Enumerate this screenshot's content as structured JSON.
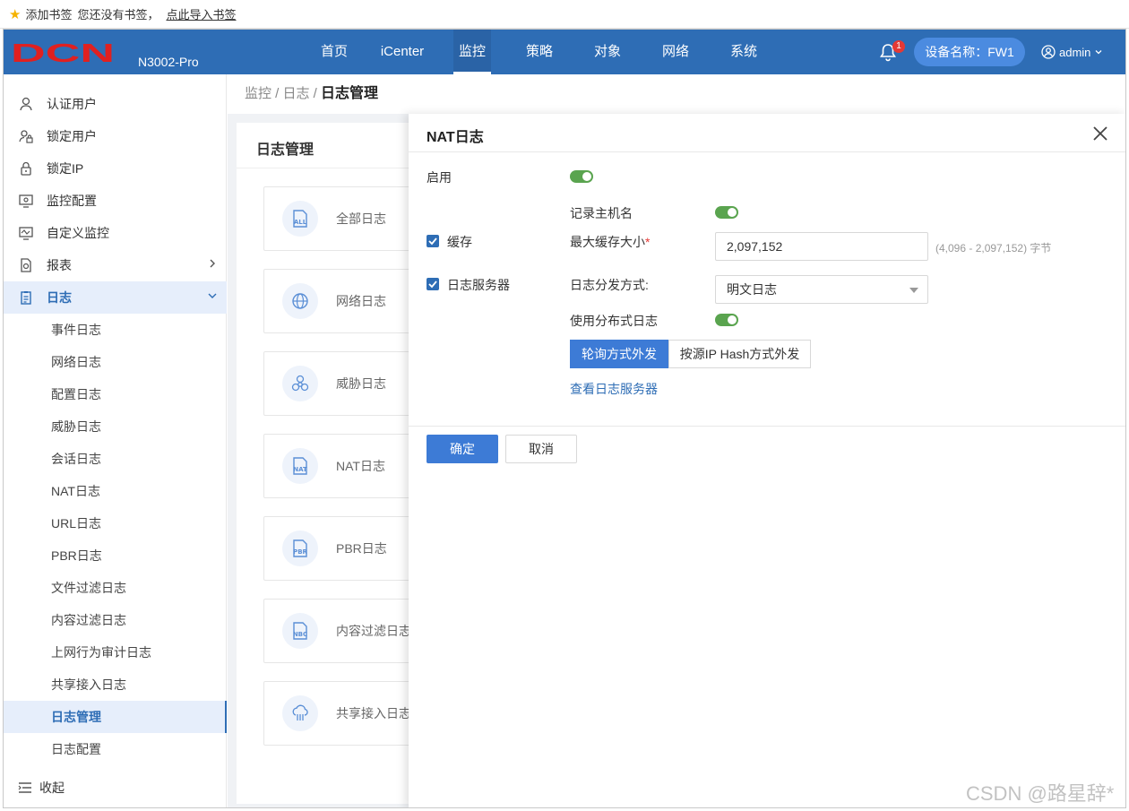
{
  "bookmark_bar": {
    "add_label": "添加书签",
    "empty_text": "您还没有书签，",
    "import_link": "点此导入书签"
  },
  "header": {
    "logo_text": "DCN",
    "model": "N3002-Pro",
    "nav": [
      "首页",
      "iCenter",
      "监控",
      "策略",
      "对象",
      "网络",
      "系统"
    ],
    "active_nav": "监控",
    "notification_count": "1",
    "device_name": "设备名称：FW1",
    "user": "admin"
  },
  "sidebar": {
    "items": [
      {
        "label": "认证用户",
        "icon": "user-icon"
      },
      {
        "label": "锁定用户",
        "icon": "user-lock-icon"
      },
      {
        "label": "锁定IP",
        "icon": "lock-icon"
      },
      {
        "label": "监控配置",
        "icon": "monitor-config-icon"
      },
      {
        "label": "自定义监控",
        "icon": "custom-monitor-icon"
      },
      {
        "label": "报表",
        "icon": "report-icon"
      },
      {
        "label": "日志",
        "icon": "log-icon"
      }
    ],
    "sub_items": [
      "事件日志",
      "网络日志",
      "配置日志",
      "威胁日志",
      "会话日志",
      "NAT日志",
      "URL日志",
      "PBR日志",
      "文件过滤日志",
      "内容过滤日志",
      "上网行为审计日志",
      "共享接入日志",
      "日志管理",
      "日志配置"
    ],
    "active_sub": "日志管理",
    "collapse_label": "收起"
  },
  "breadcrumb": {
    "path": "监控 / 日志 / ",
    "current": "日志管理"
  },
  "panel": {
    "title": "日志管理",
    "cards": [
      {
        "label": "全部日志",
        "icon": "all-log-icon"
      },
      {
        "label": "网络日志",
        "icon": "globe-icon"
      },
      {
        "label": "威胁日志",
        "icon": "biohazard-icon"
      },
      {
        "label": "NAT日志",
        "icon": "nat-file-icon"
      },
      {
        "label": "PBR日志",
        "icon": "pbr-file-icon"
      },
      {
        "label": "内容过滤日志",
        "icon": "nbc-file-icon"
      },
      {
        "label": "共享接入日志",
        "icon": "cloud-share-icon"
      }
    ]
  },
  "drawer": {
    "title": "NAT日志",
    "enable_label": "启用",
    "record_hostname_label": "记录主机名",
    "cache_label": "缓存",
    "max_cache_label": "最大缓存大小",
    "required_mark": "*",
    "max_cache_value": "2,097,152",
    "max_cache_hint": "(4,096 - 2,097,152) 字节",
    "log_server_label": "日志服务器",
    "dispatch_mode_label": "日志分发方式:",
    "dispatch_mode_value": "明文日志",
    "distributed_label": "使用分布式日志",
    "seg_poll": "轮询方式外发",
    "seg_hash": "按源IP Hash方式外发",
    "view_servers_link": "查看日志服务器",
    "ok_button": "确定",
    "cancel_button": "取消"
  },
  "watermark": "CSDN @路星辞*",
  "colors": {
    "nav_bg": "#2e6db5",
    "primary": "#3d7bd6",
    "toggle_on": "#5aa44f",
    "logo_red": "#e02020"
  }
}
